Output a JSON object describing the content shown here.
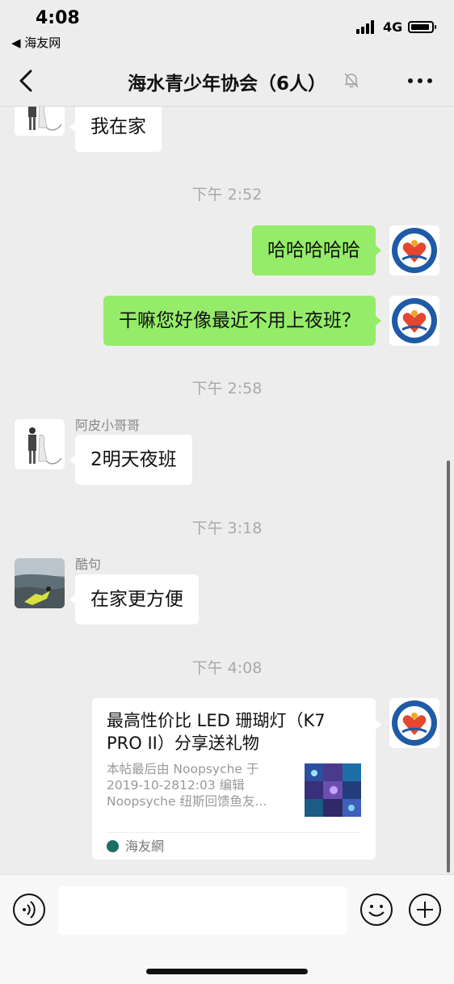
{
  "status_bar": {
    "time": "4:08",
    "back_app": "◀ 海友网",
    "network": "4G"
  },
  "nav": {
    "title": "海水青少年协会（6人）",
    "icons": {
      "back": "chevron-left-icon",
      "mute": "bell-slash-icon",
      "more": "more-dots-icon"
    }
  },
  "chat": {
    "messages": [
      {
        "kind": "text",
        "side": "left",
        "text": "我在家"
      },
      {
        "kind": "timestamp",
        "text": "下午 2:52"
      },
      {
        "kind": "text",
        "side": "right",
        "text": "哈哈哈哈哈"
      },
      {
        "kind": "text",
        "side": "right",
        "text": "干嘛您好像最近不用上夜班？"
      },
      {
        "kind": "timestamp",
        "text": "下午 2:58"
      },
      {
        "kind": "text",
        "side": "left",
        "sender": "阿皮小哥哥",
        "text": "2明天夜班"
      },
      {
        "kind": "timestamp",
        "text": "下午 3:18"
      },
      {
        "kind": "text",
        "side": "left",
        "sender": "酷句",
        "text": "在家更方便"
      },
      {
        "kind": "timestamp",
        "text": "下午 4:08"
      },
      {
        "kind": "link_card",
        "side": "right",
        "title": "最高性价比 LED 珊瑚灯（K7 PRO II）分享送礼物",
        "desc_lines": [
          "本帖最后由 Noopsyche 于",
          "2019-10-2812:03 编辑",
          "Noopsyche 纽斯回馈鱼友..."
        ],
        "source": "海友網"
      }
    ]
  },
  "input_bar": {
    "placeholder": "",
    "icons": {
      "voice": "voice-icon",
      "emoji": "emoji-icon",
      "plus": "plus-icon"
    }
  },
  "colors": {
    "background": "#ededed",
    "bubble_self": "#95ec69",
    "bubble_other": "#ffffff",
    "timestamp": "#a9a9a9"
  }
}
